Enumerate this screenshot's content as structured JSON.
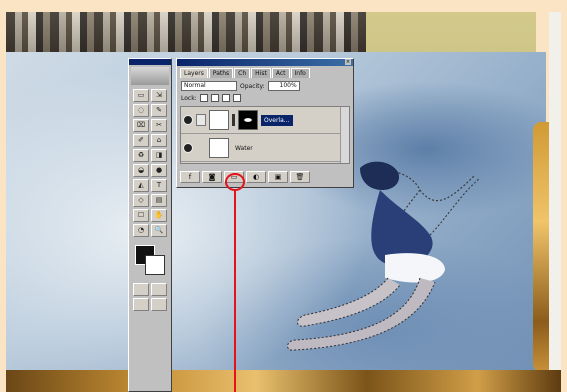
{
  "layers_panel": {
    "tabs": [
      "Layers",
      "Paths",
      "Ch",
      "Hist",
      "Act",
      "Info"
    ],
    "blend_mode": "Normal",
    "opacity_label": "Opacity:",
    "opacity_value": "100%",
    "lock_label": "Lock:",
    "layers": [
      {
        "name": "Overla...",
        "selected": true,
        "has_mask": true
      },
      {
        "name": "Water",
        "selected": false,
        "has_mask": false
      }
    ],
    "bottom_buttons": [
      "f",
      "◙",
      "▭",
      "◐",
      "▣",
      "🗑"
    ]
  },
  "toolbox": {
    "tools": [
      "▭",
      "⇲",
      "◌",
      "✎",
      "⌧",
      "✂",
      "✐",
      "⌂",
      "♻",
      "◨",
      "◒",
      "●",
      "◭",
      "T",
      "◇",
      "▤",
      "☐",
      "✋",
      "◔",
      "🔍"
    ]
  },
  "colors": {
    "highlight": "#e5121a",
    "selection": "#0a246a",
    "panel": "#c0c0c0"
  }
}
